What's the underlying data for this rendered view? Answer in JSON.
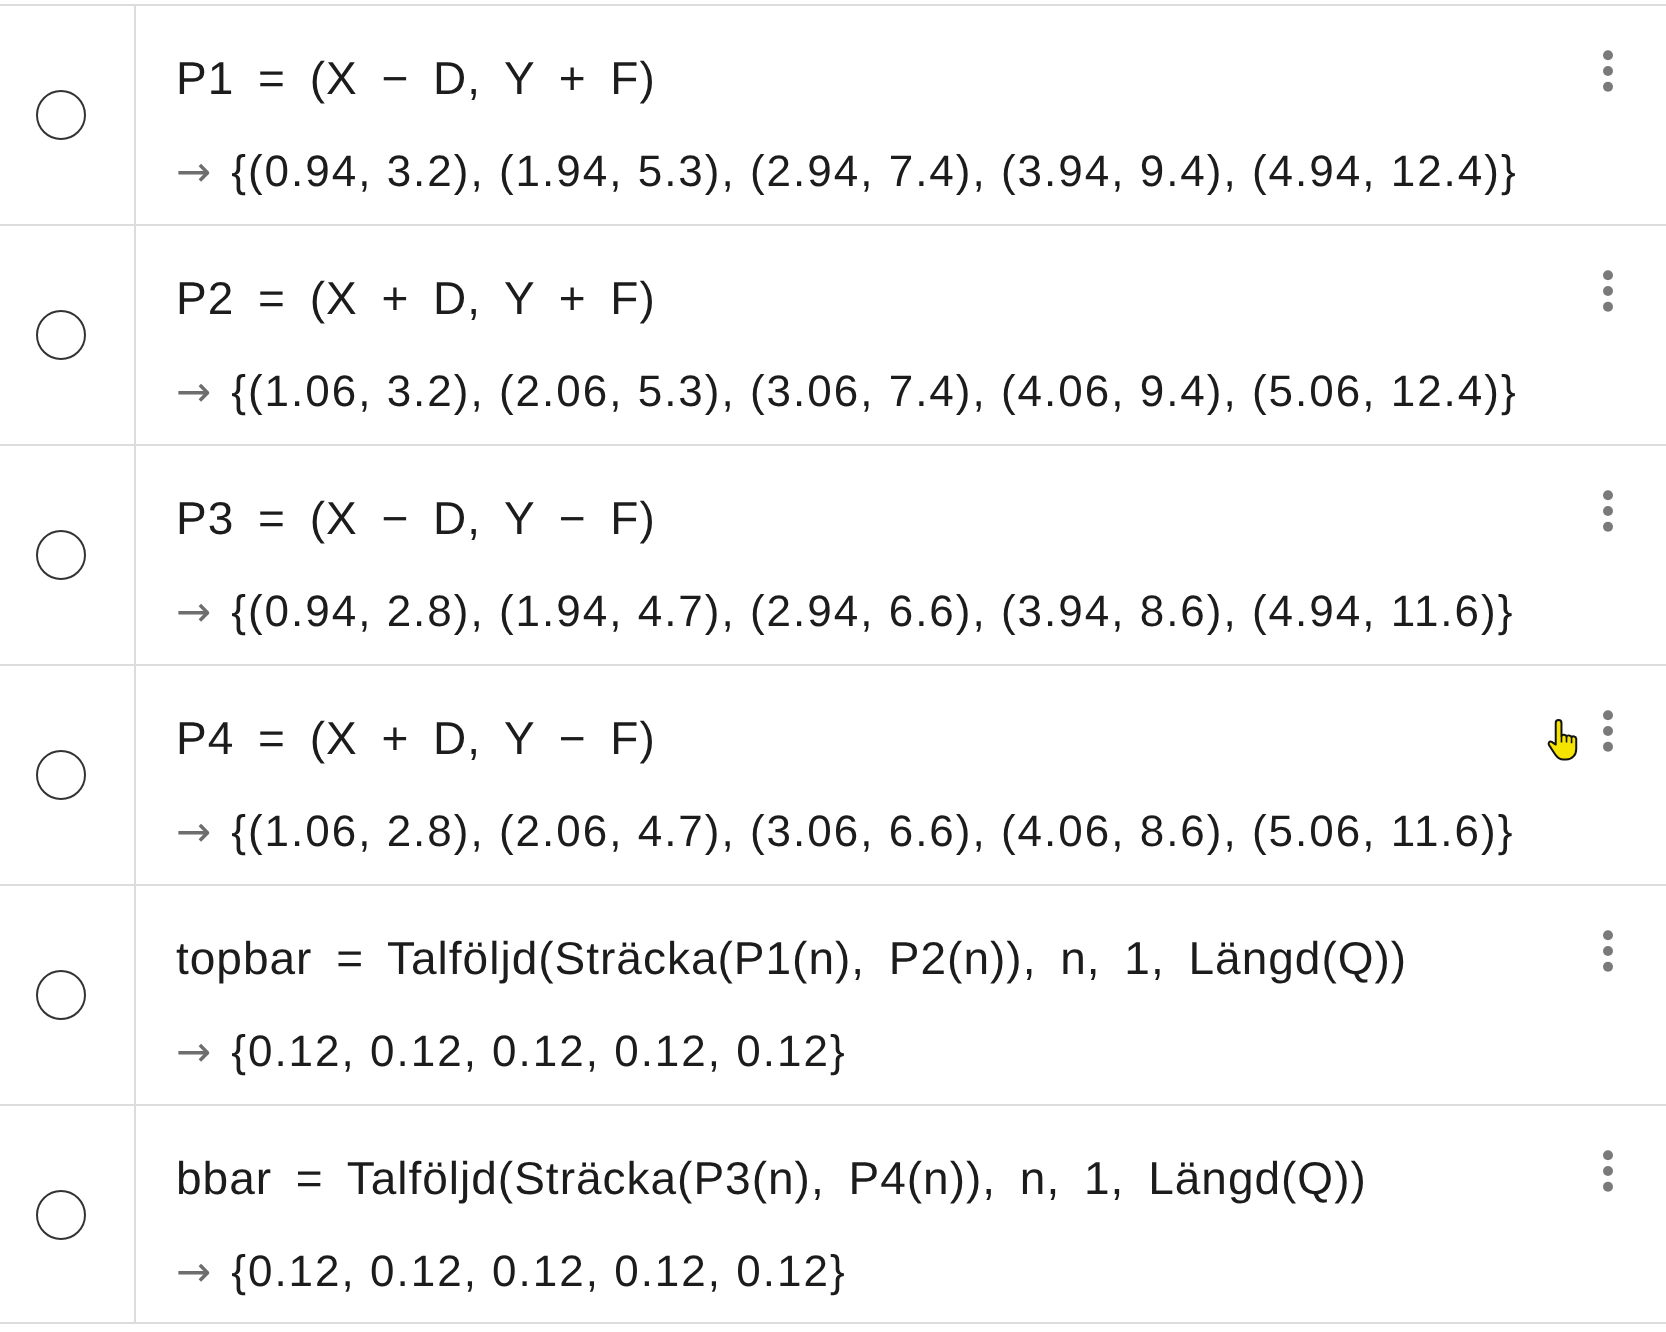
{
  "rows": [
    {
      "shown": false,
      "hovered": false,
      "definition": "P1 = (X − D, Y + F)",
      "arrow": "→",
      "output": "{(0.94, 3.2), (1.94, 5.3), (2.94, 7.4), (3.94, 9.4), (4.94, 12.4)}"
    },
    {
      "shown": false,
      "hovered": false,
      "definition": "P2 = (X + D, Y + F)",
      "arrow": "→",
      "output": "{(1.06, 3.2), (2.06, 5.3), (3.06, 7.4), (4.06, 9.4), (5.06, 12.4)}"
    },
    {
      "shown": false,
      "hovered": false,
      "definition": "P3 = (X − D, Y − F)",
      "arrow": "→",
      "output": "{(0.94, 2.8), (1.94, 4.7), (2.94, 6.6), (3.94, 8.6), (4.94, 11.6)}"
    },
    {
      "shown": false,
      "hovered": true,
      "definition": "P4 = (X + D, Y − F)",
      "arrow": "→",
      "output": "{(1.06, 2.8), (2.06, 4.7), (3.06, 6.6), (4.06, 8.6), (5.06, 11.6)}"
    },
    {
      "shown": false,
      "hovered": false,
      "definition": "topbar = Talföljd(Sträcka(P1(n), P2(n)), n, 1, Längd(Q))",
      "arrow": "→",
      "output": "{0.12, 0.12, 0.12, 0.12, 0.12}"
    },
    {
      "shown": false,
      "hovered": false,
      "definition": "bbar = Talföljd(Sträcka(P3(n), P4(n)), n, 1, Längd(Q))",
      "arrow": "→",
      "output": "{0.12, 0.12, 0.12, 0.12, 0.12}"
    }
  ]
}
